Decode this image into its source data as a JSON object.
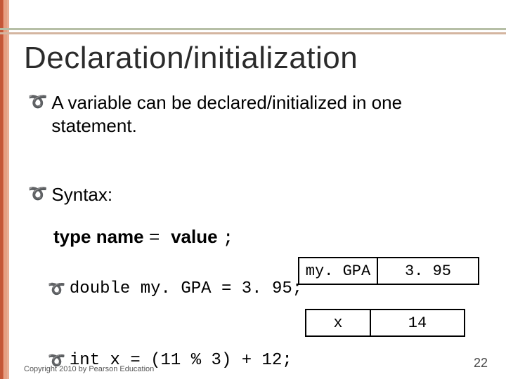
{
  "title": "Declaration/initialization",
  "bullets": {
    "b1": "A variable can be declared/initialized in one statement.",
    "b2": "Syntax:"
  },
  "syntax": {
    "type_kw": "type",
    "name_kw": "name",
    "equals": " = ",
    "value_kw": "value",
    "semicolon": ";"
  },
  "code": {
    "line1": "double my. GPA = 3. 95;",
    "line2": "int x = (11 % 3) + 12;"
  },
  "boxes": {
    "row1": {
      "name": "my. GPA",
      "value": "3. 95"
    },
    "row2": {
      "name": "x",
      "value": "14"
    }
  },
  "footer": {
    "copyright": "Copyright 2010 by Pearson Education",
    "page": "22"
  }
}
